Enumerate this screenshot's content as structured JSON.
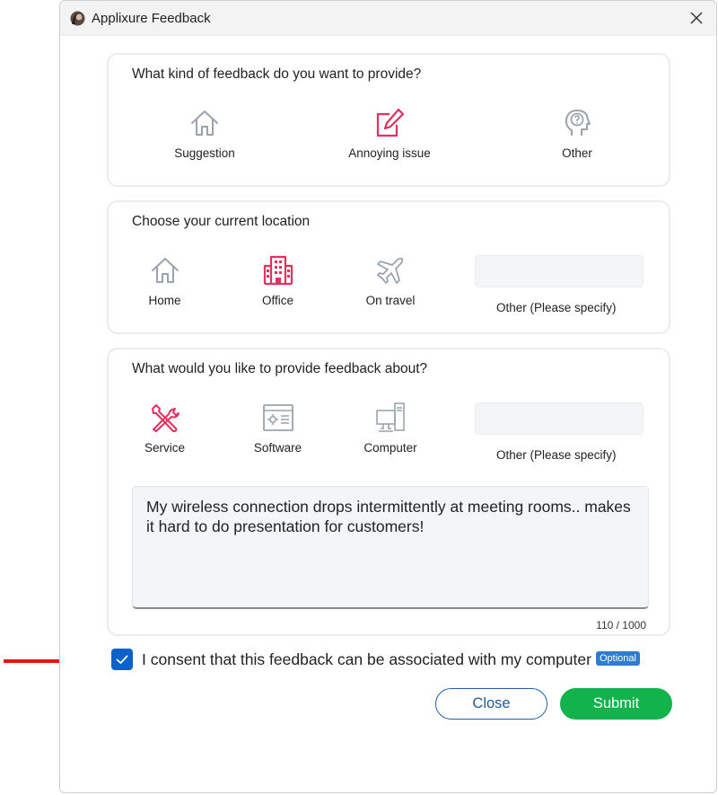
{
  "window": {
    "title": "Applixure Feedback"
  },
  "feedback_kind": {
    "question": "What kind of feedback do you want to provide?",
    "options": [
      {
        "label": "Suggestion",
        "icon": "house-icon"
      },
      {
        "label": "Annoying issue",
        "icon": "edit-note-icon",
        "selected": true
      },
      {
        "label": "Other",
        "icon": "head-question-icon"
      }
    ]
  },
  "location": {
    "question": "Choose your current location",
    "options": [
      {
        "label": "Home",
        "icon": "house-icon"
      },
      {
        "label": "Office",
        "icon": "office-building-icon",
        "selected": true
      },
      {
        "label": "On travel",
        "icon": "airplane-icon"
      }
    ],
    "other_label": "Other (Please specify)",
    "other_value": ""
  },
  "topic": {
    "question": "What would you like to provide feedback about?",
    "options": [
      {
        "label": "Service",
        "icon": "tools-icon",
        "selected": true
      },
      {
        "label": "Software",
        "icon": "software-window-icon"
      },
      {
        "label": "Computer",
        "icon": "computer-icon"
      }
    ],
    "other_label": "Other (Please specify)",
    "other_value": ""
  },
  "message": {
    "text": "My wireless connection drops intermittently at meeting rooms.. makes it hard to do presentation for customers!",
    "counter": "110 / 1000"
  },
  "consent": {
    "checked": true,
    "label": "I consent that this feedback can be associated with my computer",
    "badge": "Optional"
  },
  "buttons": {
    "close": "Close",
    "submit": "Submit"
  },
  "colors": {
    "selected": "#e3305f",
    "unselected": "#9aa3ad",
    "checkbox": "#0d62c9",
    "submit": "#12b34c",
    "close_border": "#2060a8",
    "annotation_arrow": "#e81416"
  }
}
